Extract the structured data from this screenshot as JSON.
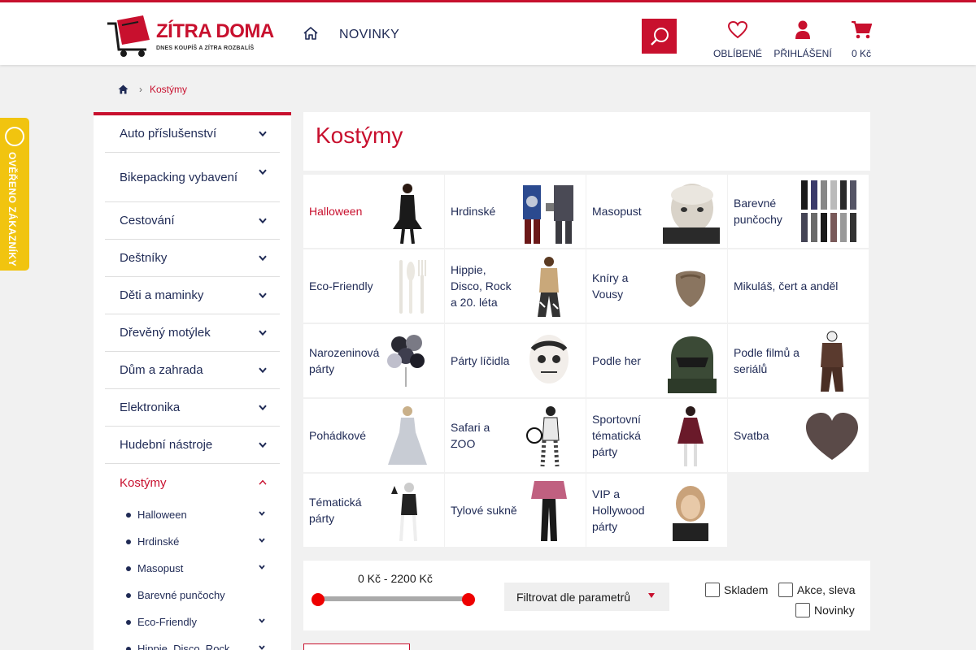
{
  "header": {
    "logo_title": "ZÍTRA DOMA",
    "logo_subtitle": "DNES KOUPÍŠ A ZÍTRA ROZBALÍŠ",
    "nav_news": "NOVINKY",
    "favorites_label": "OBLÍBENÉ",
    "login_label": "PŘIHLÁŠENÍ",
    "cart_label": "0 Kč",
    "accent_color": "#c8102e"
  },
  "breadcrumb": {
    "current": "Kostýmy"
  },
  "badge": {
    "text": "OVĚŘENO ZÁKAZNÍKY"
  },
  "sidebar": {
    "categories": [
      {
        "label": "Auto příslušenství"
      },
      {
        "label": "Bikepacking vybavení"
      },
      {
        "label": "Cestování"
      },
      {
        "label": "Deštníky"
      },
      {
        "label": "Děti a maminky"
      },
      {
        "label": "Dřevěný motýlek"
      },
      {
        "label": "Dům a zahrada"
      },
      {
        "label": "Elektronika"
      },
      {
        "label": "Hudební nástroje"
      },
      {
        "label": "Kostýmy"
      }
    ],
    "subcategories": [
      {
        "label": "Halloween"
      },
      {
        "label": "Hrdinské"
      },
      {
        "label": "Masopust"
      },
      {
        "label": "Barevné punčochy"
      },
      {
        "label": "Eco-Friendly"
      },
      {
        "label": "Hippie, Disco, Rock"
      }
    ]
  },
  "main": {
    "title": "Kostýmy",
    "tiles": [
      {
        "label": "Halloween"
      },
      {
        "label": "Hrdinské"
      },
      {
        "label": "Masopust"
      },
      {
        "label": "Barevné punčochy"
      },
      {
        "label": "Eco-Friendly"
      },
      {
        "label": "Hippie, Disco, Rock a 20. léta"
      },
      {
        "label": "Kníry a Vousy"
      },
      {
        "label": "Mikuláš, čert a anděl"
      },
      {
        "label": "Narozeninová párty"
      },
      {
        "label": "Párty líčidla"
      },
      {
        "label": "Podle her"
      },
      {
        "label": "Podle filmů a seriálů"
      },
      {
        "label": "Pohádkové"
      },
      {
        "label": "Safari a ZOO"
      },
      {
        "label": "Sportovní tématická párty"
      },
      {
        "label": "Svatba"
      },
      {
        "label": "Tématická párty"
      },
      {
        "label": "Tylové sukně"
      },
      {
        "label": "VIP a Hollywood párty"
      }
    ]
  },
  "filter": {
    "price_range": "0 Kč - 2200 Kč",
    "price_min_fraction": 0,
    "price_max_fraction": 1,
    "dropdown_label": "Filtrovat dle parametrů",
    "in_stock_label": "Skladem",
    "sale_label": "Akce, sleva",
    "new_label": "Novinky"
  }
}
